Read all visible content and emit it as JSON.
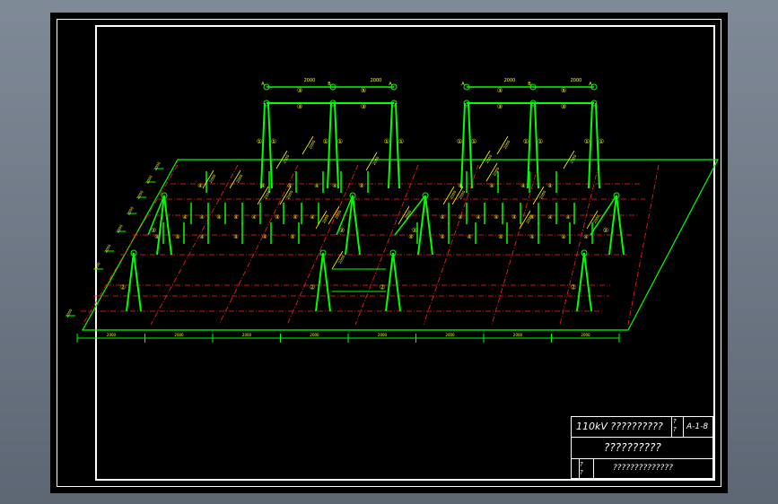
{
  "titleblock": {
    "project": "110kV ??????????",
    "code_mark": "?\n?",
    "drawing_no": "A-1-8",
    "drawing_title": "??????????",
    "small_marks": [
      "?\n?",
      "?\n?"
    ],
    "bottom_text": "??????????????"
  },
  "drawing": {
    "colors": {
      "frame": "#ffffff",
      "structure": "#00ff00",
      "axis": "#ff2020",
      "annotation": "#ffff00"
    },
    "circled_labels": [
      "①",
      "②",
      "③",
      "④",
      "⑤"
    ],
    "beam_labels": [
      "A",
      "B",
      "A"
    ],
    "dimension_label": "2000"
  }
}
